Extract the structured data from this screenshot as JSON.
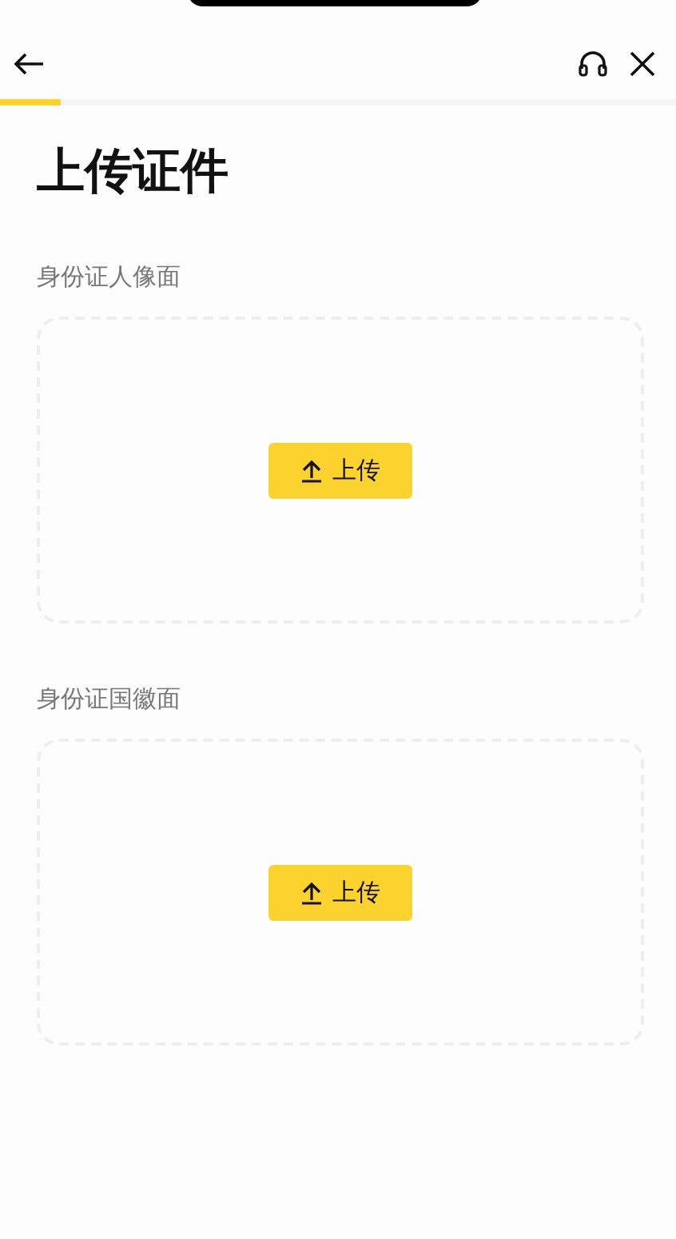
{
  "progress": {
    "level": 0.09
  },
  "title": "上传证件",
  "sections": [
    {
      "label": "身份证人像面",
      "button": "上传"
    },
    {
      "label": "身份证国徽面",
      "button": "上传"
    }
  ]
}
